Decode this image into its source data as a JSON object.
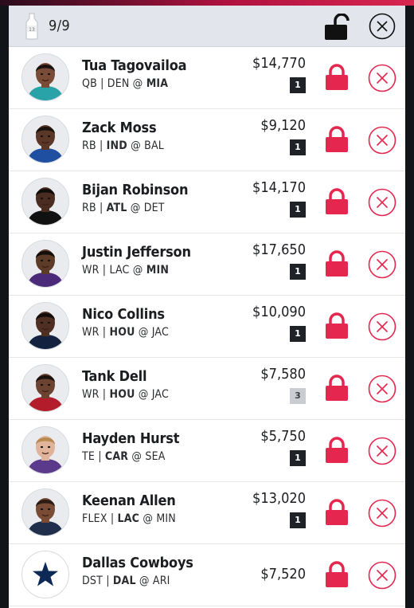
{
  "header": {
    "count": "9/9",
    "bottle_label": "13"
  },
  "colors": {
    "accent": "#e5274f",
    "badge_dark": "#1f2226",
    "badge_light": "#c9ccd1"
  },
  "players": [
    {
      "name": "Tua Tagovailoa",
      "pos": "QB",
      "team": "DEN",
      "opp": "MIA",
      "home": "opp",
      "salary": "$14,770",
      "badge": "1",
      "badge_style": "dark",
      "kind": "player",
      "skin": "#7a4b36",
      "hair": "#1a1210",
      "jersey": "#2aa3a8"
    },
    {
      "name": "Zack Moss",
      "pos": "RB",
      "team": "IND",
      "opp": "BAL",
      "home": "team",
      "salary": "$9,120",
      "badge": "1",
      "badge_style": "dark",
      "kind": "player",
      "skin": "#5a3726",
      "hair": "#1a120c",
      "jersey": "#1f4fa0"
    },
    {
      "name": "Bijan Robinson",
      "pos": "RB",
      "team": "ATL",
      "opp": "DET",
      "home": "team",
      "salary": "$14,170",
      "badge": "1",
      "badge_style": "dark",
      "kind": "player",
      "skin": "#4a2d20",
      "hair": "#100c0a",
      "jersey": "#111111"
    },
    {
      "name": "Justin Jefferson",
      "pos": "WR",
      "team": "LAC",
      "opp": "MIN",
      "home": "opp",
      "salary": "$17,650",
      "badge": "1",
      "badge_style": "dark",
      "kind": "player",
      "skin": "#5e3a28",
      "hair": "#140e0b",
      "jersey": "#4b2a7a"
    },
    {
      "name": "Nico Collins",
      "pos": "WR",
      "team": "HOU",
      "opp": "JAC",
      "home": "team",
      "salary": "$10,090",
      "badge": "1",
      "badge_style": "dark",
      "kind": "player",
      "skin": "#4e2f21",
      "hair": "#120c0a",
      "jersey": "#13233f"
    },
    {
      "name": "Tank Dell",
      "pos": "WR",
      "team": "HOU",
      "opp": "JAC",
      "home": "team",
      "salary": "$7,580",
      "badge": "3",
      "badge_style": "light",
      "kind": "player",
      "skin": "#6b4330",
      "hair": "#1a120d",
      "jersey": "#b31c2b"
    },
    {
      "name": "Hayden Hurst",
      "pos": "TE",
      "team": "CAR",
      "opp": "SEA",
      "home": "team",
      "salary": "$5,750",
      "badge": "1",
      "badge_style": "dark",
      "kind": "player",
      "skin": "#e0b49a",
      "hair": "#b88a52",
      "jersey": "#5b3a8c"
    },
    {
      "name": "Keenan Allen",
      "pos": "FLEX",
      "team": "LAC",
      "opp": "MIN",
      "home": "team",
      "salary": "$13,020",
      "badge": "1",
      "badge_style": "dark",
      "kind": "player",
      "skin": "#7a4c36",
      "hair": "#2a1c15",
      "jersey": "#1f2e4a"
    },
    {
      "name": "Dallas Cowboys",
      "pos": "DST",
      "team": "DAL",
      "opp": "ARI",
      "home": "team",
      "salary": "$7,520",
      "badge": "",
      "badge_style": "none",
      "kind": "team",
      "skin": "",
      "hair": "",
      "jersey": ""
    }
  ]
}
